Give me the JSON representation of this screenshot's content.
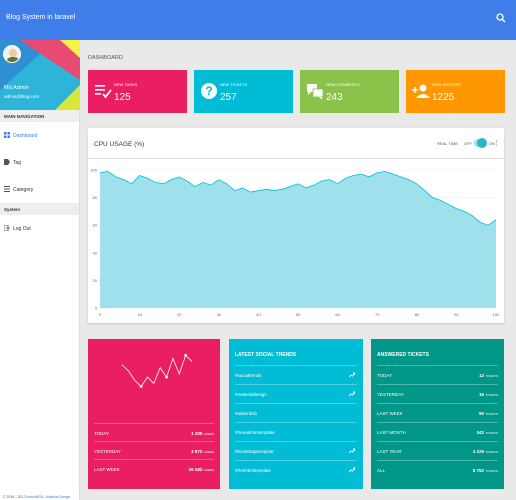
{
  "topbar": {
    "title": "Blog System in laravel"
  },
  "user": {
    "name": "Md.Admin",
    "email": "admin@blog.com"
  },
  "nav": {
    "main_heading": "MAIN NAVIGATION",
    "items": [
      {
        "label": "Dashboard",
        "active": true
      },
      {
        "label": "Tag"
      },
      {
        "label": "Category"
      }
    ],
    "system_heading": "System",
    "system_items": [
      {
        "label": "Log Out"
      }
    ]
  },
  "footer": {
    "copyright": "© 2016 - 2017 ",
    "link": "AdminBSB - Material Design"
  },
  "breadcrumb": "DASHBOARD",
  "tiles": [
    {
      "label": "NEW TASKS",
      "value": "125",
      "color": "#e91e63",
      "icon": "playlist-check-icon"
    },
    {
      "label": "NEW TICKETS",
      "value": "257",
      "color": "#00bcd4",
      "icon": "help-circle-icon"
    },
    {
      "label": "NEW COMMENTS",
      "value": "243",
      "color": "#8bc34a",
      "icon": "forum-icon"
    },
    {
      "label": "NEW VISITORS",
      "value": "1225",
      "color": "#ff9800",
      "icon": "person-add-icon"
    }
  ],
  "cpu": {
    "title": "CPU USAGE (%)",
    "realtime_label": "REAL TIME",
    "off_label": "OFF",
    "on_label": "ON",
    "realtime_on": true
  },
  "chart_data": {
    "type": "area",
    "title": "CPU USAGE (%)",
    "xlabel": "",
    "ylabel": "",
    "xlim": [
      0,
      100
    ],
    "ylim": [
      0,
      100
    ],
    "x_ticks": [
      0,
      10,
      20,
      30,
      40,
      50,
      60,
      70,
      80,
      90,
      100
    ],
    "y_ticks": [
      0,
      20,
      40,
      60,
      80,
      100
    ],
    "color": "#9ee0ec",
    "stroke": "#00bcd4",
    "x": [
      0,
      2,
      4,
      6,
      8,
      10,
      12,
      14,
      16,
      18,
      20,
      22,
      24,
      26,
      28,
      30,
      32,
      34,
      36,
      38,
      40,
      42,
      44,
      46,
      48,
      50,
      52,
      54,
      56,
      58,
      60,
      62,
      64,
      66,
      68,
      70,
      72,
      74,
      76,
      78,
      80,
      82,
      84,
      86,
      88,
      90,
      92,
      94,
      96,
      98,
      100
    ],
    "values": [
      98,
      99,
      95,
      93,
      90,
      96,
      94,
      91,
      90,
      93,
      95,
      92,
      88,
      91,
      89,
      93,
      90,
      85,
      87,
      84,
      85,
      86,
      85,
      86,
      88,
      90,
      87,
      89,
      92,
      93,
      90,
      94,
      96,
      97,
      95,
      98,
      99,
      97,
      95,
      93,
      90,
      85,
      80,
      78,
      75,
      72,
      70,
      67,
      62,
      60,
      64
    ]
  },
  "social": {
    "sparkline": [
      55,
      45,
      30,
      20,
      35,
      25,
      50,
      35,
      65,
      40,
      70,
      60
    ],
    "rows": [
      {
        "label": "TODAY",
        "value": "1 200",
        "unit": "USERS"
      },
      {
        "label": "YESTERDAY",
        "value": "3 872",
        "unit": "USERS"
      },
      {
        "label": "LAST WEEK",
        "value": "26 582",
        "unit": "USERS"
      }
    ]
  },
  "trends": {
    "title": "LATEST SOCIAL TRENDS",
    "items": [
      {
        "tag": "#socialtrends",
        "trending": true
      },
      {
        "tag": "#materialdesign",
        "trending": true
      },
      {
        "tag": "#adminbsb",
        "trending": false
      },
      {
        "tag": "#freeadmintemplate",
        "trending": false
      },
      {
        "tag": "#bootstraptemplate",
        "trending": true
      },
      {
        "tag": "#freehtmltemplate",
        "trending": true
      }
    ]
  },
  "tickets": {
    "title": "ANSWERED TICKETS",
    "rows": [
      {
        "label": "TODAY",
        "value": "12",
        "unit": "TICKETS"
      },
      {
        "label": "YESTERDAY",
        "value": "15",
        "unit": "TICKETS"
      },
      {
        "label": "LAST WEEK",
        "value": "90",
        "unit": "TICKETS"
      },
      {
        "label": "LAST MONTH",
        "value": "342",
        "unit": "TICKETS"
      },
      {
        "label": "LAST YEAR",
        "value": "4 225",
        "unit": "TICKETS"
      },
      {
        "label": "ALL",
        "value": "8 752",
        "unit": "TICKETS"
      }
    ]
  }
}
